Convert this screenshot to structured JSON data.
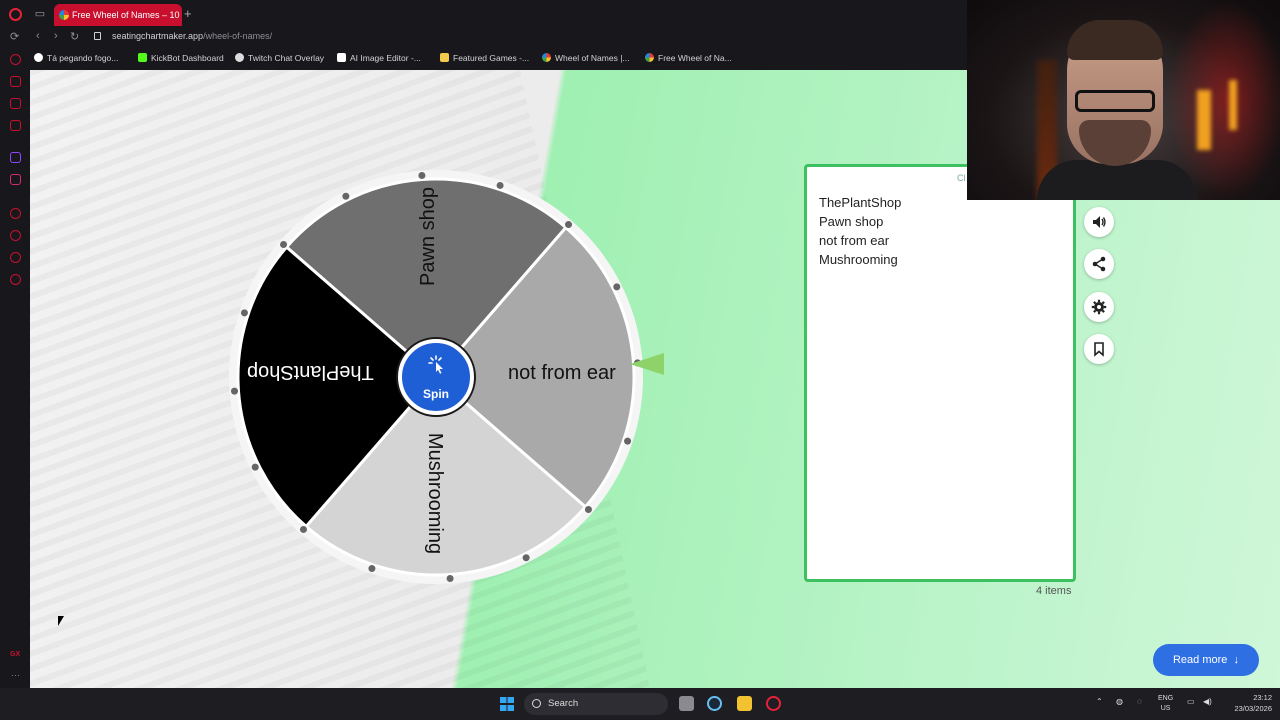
{
  "browser": {
    "tab_title": "Free Wheel of Names – 10",
    "url_domain": "seatingchartmaker.app",
    "url_path": "/wheel-of-names/",
    "bookmarks": [
      {
        "label": "Tá pegando fogo...",
        "color": "#4caf50"
      },
      {
        "label": "KickBot Dashboard",
        "color": "#53fc18"
      },
      {
        "label": "Twitch Chat Overlay",
        "color": "#dddddd"
      },
      {
        "label": "AI Image Editor -...",
        "color": "#ffffff"
      },
      {
        "label": "Featured Games -...",
        "color": "#f2c94c"
      },
      {
        "label": "Wheel of Names |...",
        "color": "#e53935"
      },
      {
        "label": "Free Wheel of Na...",
        "color": "#e53935"
      }
    ],
    "sidebar_gx": "GX",
    "sidebar_more": "···"
  },
  "wheel": {
    "slices": [
      {
        "label": "Pawn shop",
        "color": "#6f6f6f"
      },
      {
        "label": "not from ear",
        "color": "#a9a9a9"
      },
      {
        "label": "Mushrooming",
        "color": "#d4d4d4"
      },
      {
        "label": "ThePlantShop",
        "color": "#000000"
      }
    ],
    "spin_label": "Spin",
    "pointer_color": "#8ed36a"
  },
  "entries": {
    "text": "ThePlantShop\nPawn shop\nnot from ear\nMushrooming",
    "count": "4 items",
    "clear_tag": "Cl"
  },
  "actions": {
    "sound": "speaker-icon",
    "share": "share-icon",
    "settings": "gear-icon",
    "save": "bookmark-icon"
  },
  "read_more": "Read more",
  "taskbar": {
    "search": "Search",
    "lang_top": "ENG",
    "lang_bottom": "US",
    "time": "23:12",
    "date": "23/03/2026"
  },
  "colors": {
    "accent": "#2f6fe4",
    "entries_border": "#3dc060",
    "opera_red": "#c8102e"
  }
}
